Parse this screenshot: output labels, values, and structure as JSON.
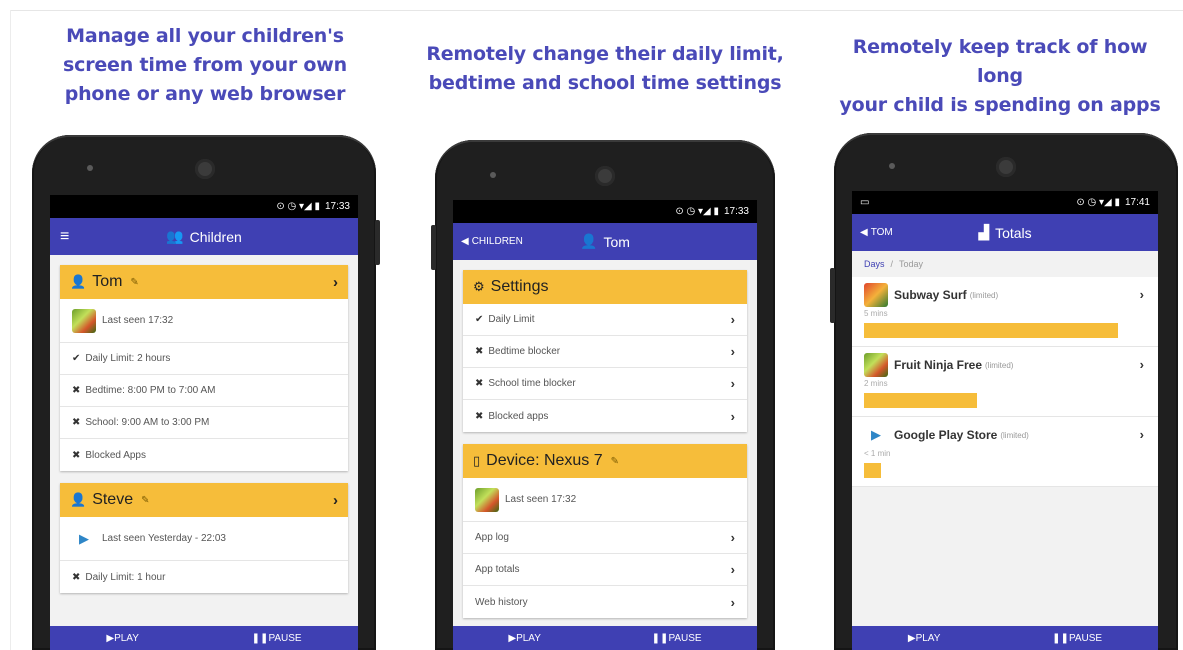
{
  "captions": [
    [
      "Manage all your children's",
      "screen time from your own",
      "phone or any web browser"
    ],
    [
      "Remotely change their daily limit,",
      "bedtime and school time settings"
    ],
    [
      "Remotely keep track of how long",
      "your child is spending on apps"
    ]
  ],
  "colors": {
    "primary": "#3f40b3",
    "accent": "#f6bd3a",
    "caption": "#4a4ab8"
  },
  "phone1": {
    "time": "17:33",
    "title": "Children",
    "tom": {
      "name": "Tom",
      "last_seen": "Last seen 17:32",
      "rows": [
        "Daily Limit: 2 hours",
        "Bedtime: 8:00 PM to 7:00 AM",
        "School: 9:00 AM to 3:00 PM",
        "Blocked Apps"
      ]
    },
    "steve": {
      "name": "Steve",
      "last_seen": "Last seen Yesterday - 22:03",
      "rows": [
        "Daily Limit: 1 hour"
      ]
    },
    "play": "PLAY",
    "pause": "PAUSE"
  },
  "phone2": {
    "time": "17:33",
    "back": "CHILDREN",
    "title": "Tom",
    "settings": {
      "title": "Settings",
      "rows": [
        "Daily Limit",
        "Bedtime blocker",
        "School time blocker",
        "Blocked apps"
      ]
    },
    "device": {
      "title": "Device: Nexus 7",
      "last_seen": "Last seen 17:32",
      "rows": [
        "App log",
        "App totals",
        "Web history"
      ]
    },
    "play": "PLAY",
    "pause": "PAUSE"
  },
  "phone3": {
    "time": "17:41",
    "back": "TOM",
    "title": "Totals",
    "tabs": {
      "days": "Days",
      "sep": "/",
      "today": "Today"
    },
    "apps": [
      {
        "name": "Subway Surf",
        "tag": "(limited)",
        "duration": "5 mins",
        "fraction": 0.9
      },
      {
        "name": "Fruit Ninja Free",
        "tag": "(limited)",
        "duration": "2 mins",
        "fraction": 0.4
      },
      {
        "name": "Google Play Store",
        "tag": "(limited)",
        "duration": "< 1 min",
        "fraction": 0.05
      }
    ],
    "play": "PLAY",
    "pause": "PAUSE"
  }
}
